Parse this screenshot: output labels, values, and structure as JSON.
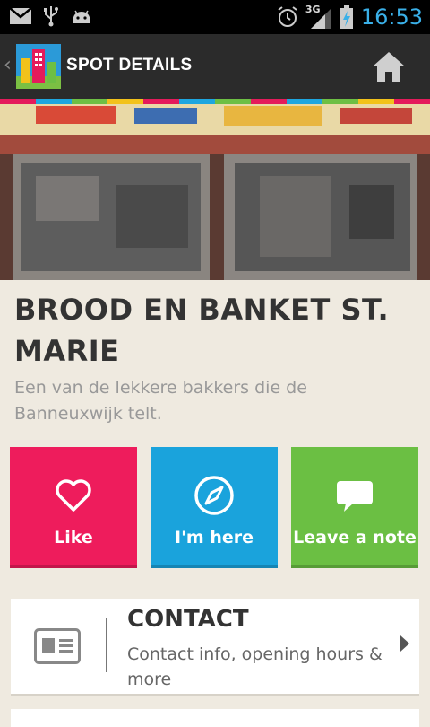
{
  "status_bar": {
    "time": "16:53",
    "network": "3G",
    "icons": [
      "gmail-icon",
      "usb-icon",
      "android-icon",
      "alarm-icon",
      "signal-icon",
      "battery-icon"
    ]
  },
  "app_bar": {
    "title": "SPOT DETAILS",
    "logo": "city-logo-icon",
    "home": "home-icon"
  },
  "colors": {
    "stripe": [
      "#e41b5b",
      "#1ea6df",
      "#6dbf44",
      "#f2c21b",
      "#e41b5b",
      "#1ea6df",
      "#6dbf44",
      "#e41b5b",
      "#1ea6df",
      "#6dbf44",
      "#f2c21b",
      "#e41b5b"
    ],
    "like": "#ee1c5c",
    "here": "#1aa3dc",
    "note": "#6bbf43"
  },
  "spot": {
    "title": "BROOD EN BANKET ST. MARIE",
    "description": "Een van de lekkere bakkers die de Banneuxwijk telt."
  },
  "actions": [
    {
      "label": "Like",
      "icon": "heart-icon"
    },
    {
      "label": "I'm here",
      "icon": "compass-icon"
    },
    {
      "label": "Leave a note",
      "icon": "speech-bubble-icon"
    }
  ],
  "contact_card": {
    "title": "CONTACT",
    "description": "Contact info, opening hours & more",
    "icon": "id-card-icon"
  }
}
